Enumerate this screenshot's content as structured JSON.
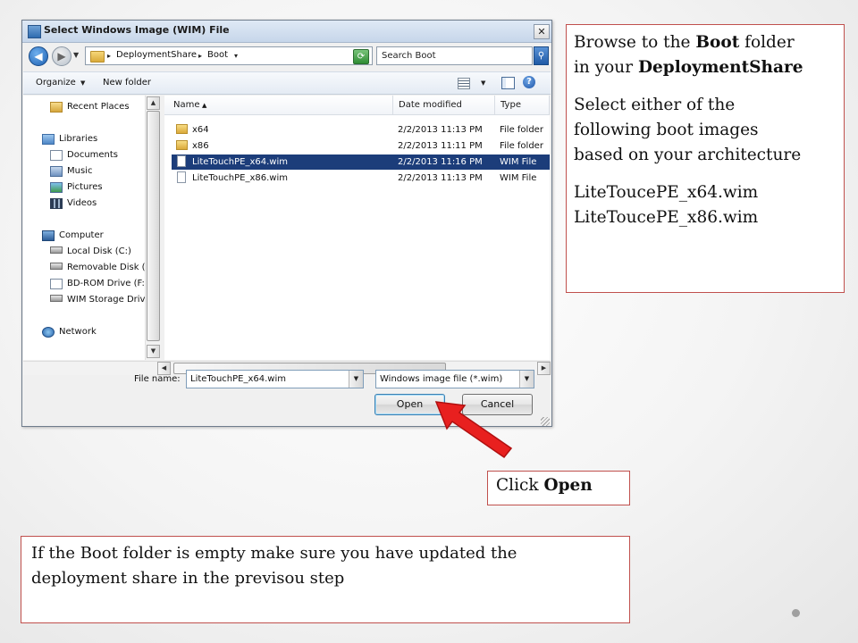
{
  "dialog": {
    "title": "Select Windows Image (WIM) File",
    "close_glyph": "✕",
    "address": {
      "segments": [
        "DeploymentShare",
        "Boot"
      ]
    },
    "search_placeholder": "Search Boot",
    "toolbar": {
      "organize_label": "Organize",
      "new_folder_label": "New folder"
    },
    "nav_pane": {
      "items": [
        {
          "label": "Recent Places",
          "icon": "recent-places-icon"
        },
        {
          "label": "Libraries",
          "icon": "libraries-icon"
        },
        {
          "label": "Documents",
          "icon": "documents-icon"
        },
        {
          "label": "Music",
          "icon": "music-icon"
        },
        {
          "label": "Pictures",
          "icon": "pictures-icon"
        },
        {
          "label": "Videos",
          "icon": "videos-icon"
        },
        {
          "label": "Computer",
          "icon": "computer-icon"
        },
        {
          "label": "Local Disk (C:)",
          "icon": "disk-icon"
        },
        {
          "label": "Removable Disk (E:",
          "icon": "removable-disk-icon"
        },
        {
          "label": "BD-ROM Drive (F:)",
          "icon": "bd-rom-icon"
        },
        {
          "label": "WIM Storage Drive",
          "icon": "wim-drive-icon"
        },
        {
          "label": "Network",
          "icon": "network-icon"
        }
      ],
      "selected": "WIM Storage Drive"
    },
    "columns": {
      "name": "Name",
      "date": "Date modified",
      "type": "Type"
    },
    "files": [
      {
        "name": "x64",
        "date": "2/2/2013 11:13 PM",
        "type": "File folder",
        "kind": "folder"
      },
      {
        "name": "x86",
        "date": "2/2/2013 11:11 PM",
        "type": "File folder",
        "kind": "folder"
      },
      {
        "name": "LiteTouchPE_x64.wim",
        "date": "2/2/2013 11:16 PM",
        "type": "WIM File",
        "kind": "file",
        "selected": true
      },
      {
        "name": "LiteTouchPE_x86.wim",
        "date": "2/2/2013 11:13 PM",
        "type": "WIM File",
        "kind": "file"
      }
    ],
    "file_name_label": "File name:",
    "file_name_value": "LiteTouchPE_x64.wim",
    "file_type_value": "Windows image file (*.wim)",
    "open_label": "Open",
    "cancel_label": "Cancel"
  },
  "callouts": {
    "browse": {
      "line1_pre": "Browse to the ",
      "line1_bold": "Boot",
      "line1_post": " folder",
      "line2_pre": "in your ",
      "line2_bold": "DeploymentShare",
      "select_1": "Select either of the",
      "select_2": "following boot images",
      "select_3": "based on your architecture",
      "image_1": "LiteToucePE_x64.wim",
      "image_2": "LiteToucePE_x86.wim"
    },
    "click_open": {
      "pre": "Click ",
      "bold": "Open"
    },
    "empty_note": {
      "line1": "If the Boot folder is empty make sure you have updated the",
      "line2": "deployment share in the previsou step"
    }
  },
  "colors": {
    "arrow": "#e8201f",
    "callout_border": "#c0504d",
    "selection": "#1c3d7a"
  }
}
